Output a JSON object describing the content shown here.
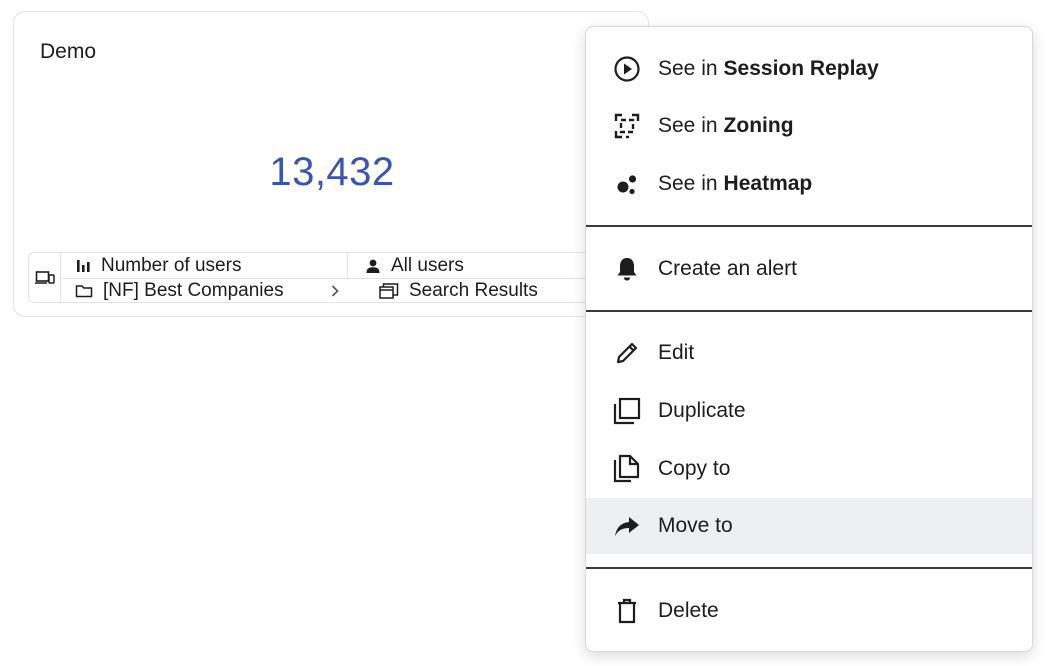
{
  "card": {
    "title": "Demo",
    "metric_value": "13,432",
    "meta": {
      "metric_label": "Number of users",
      "segment_label": "All users",
      "folder_label": "[NF] Best Companies",
      "page_label": "Search Results"
    }
  },
  "menu": {
    "see_in_prefix": "See in",
    "session_replay": "Session Replay",
    "zoning": "Zoning",
    "heatmap": "Heatmap",
    "create_alert": "Create an alert",
    "edit": "Edit",
    "duplicate": "Duplicate",
    "copy_to": "Copy to",
    "move_to": "Move to",
    "delete": "Delete"
  },
  "colors": {
    "metric": "#3a55b0",
    "hover_bg": "#eeeff1"
  }
}
